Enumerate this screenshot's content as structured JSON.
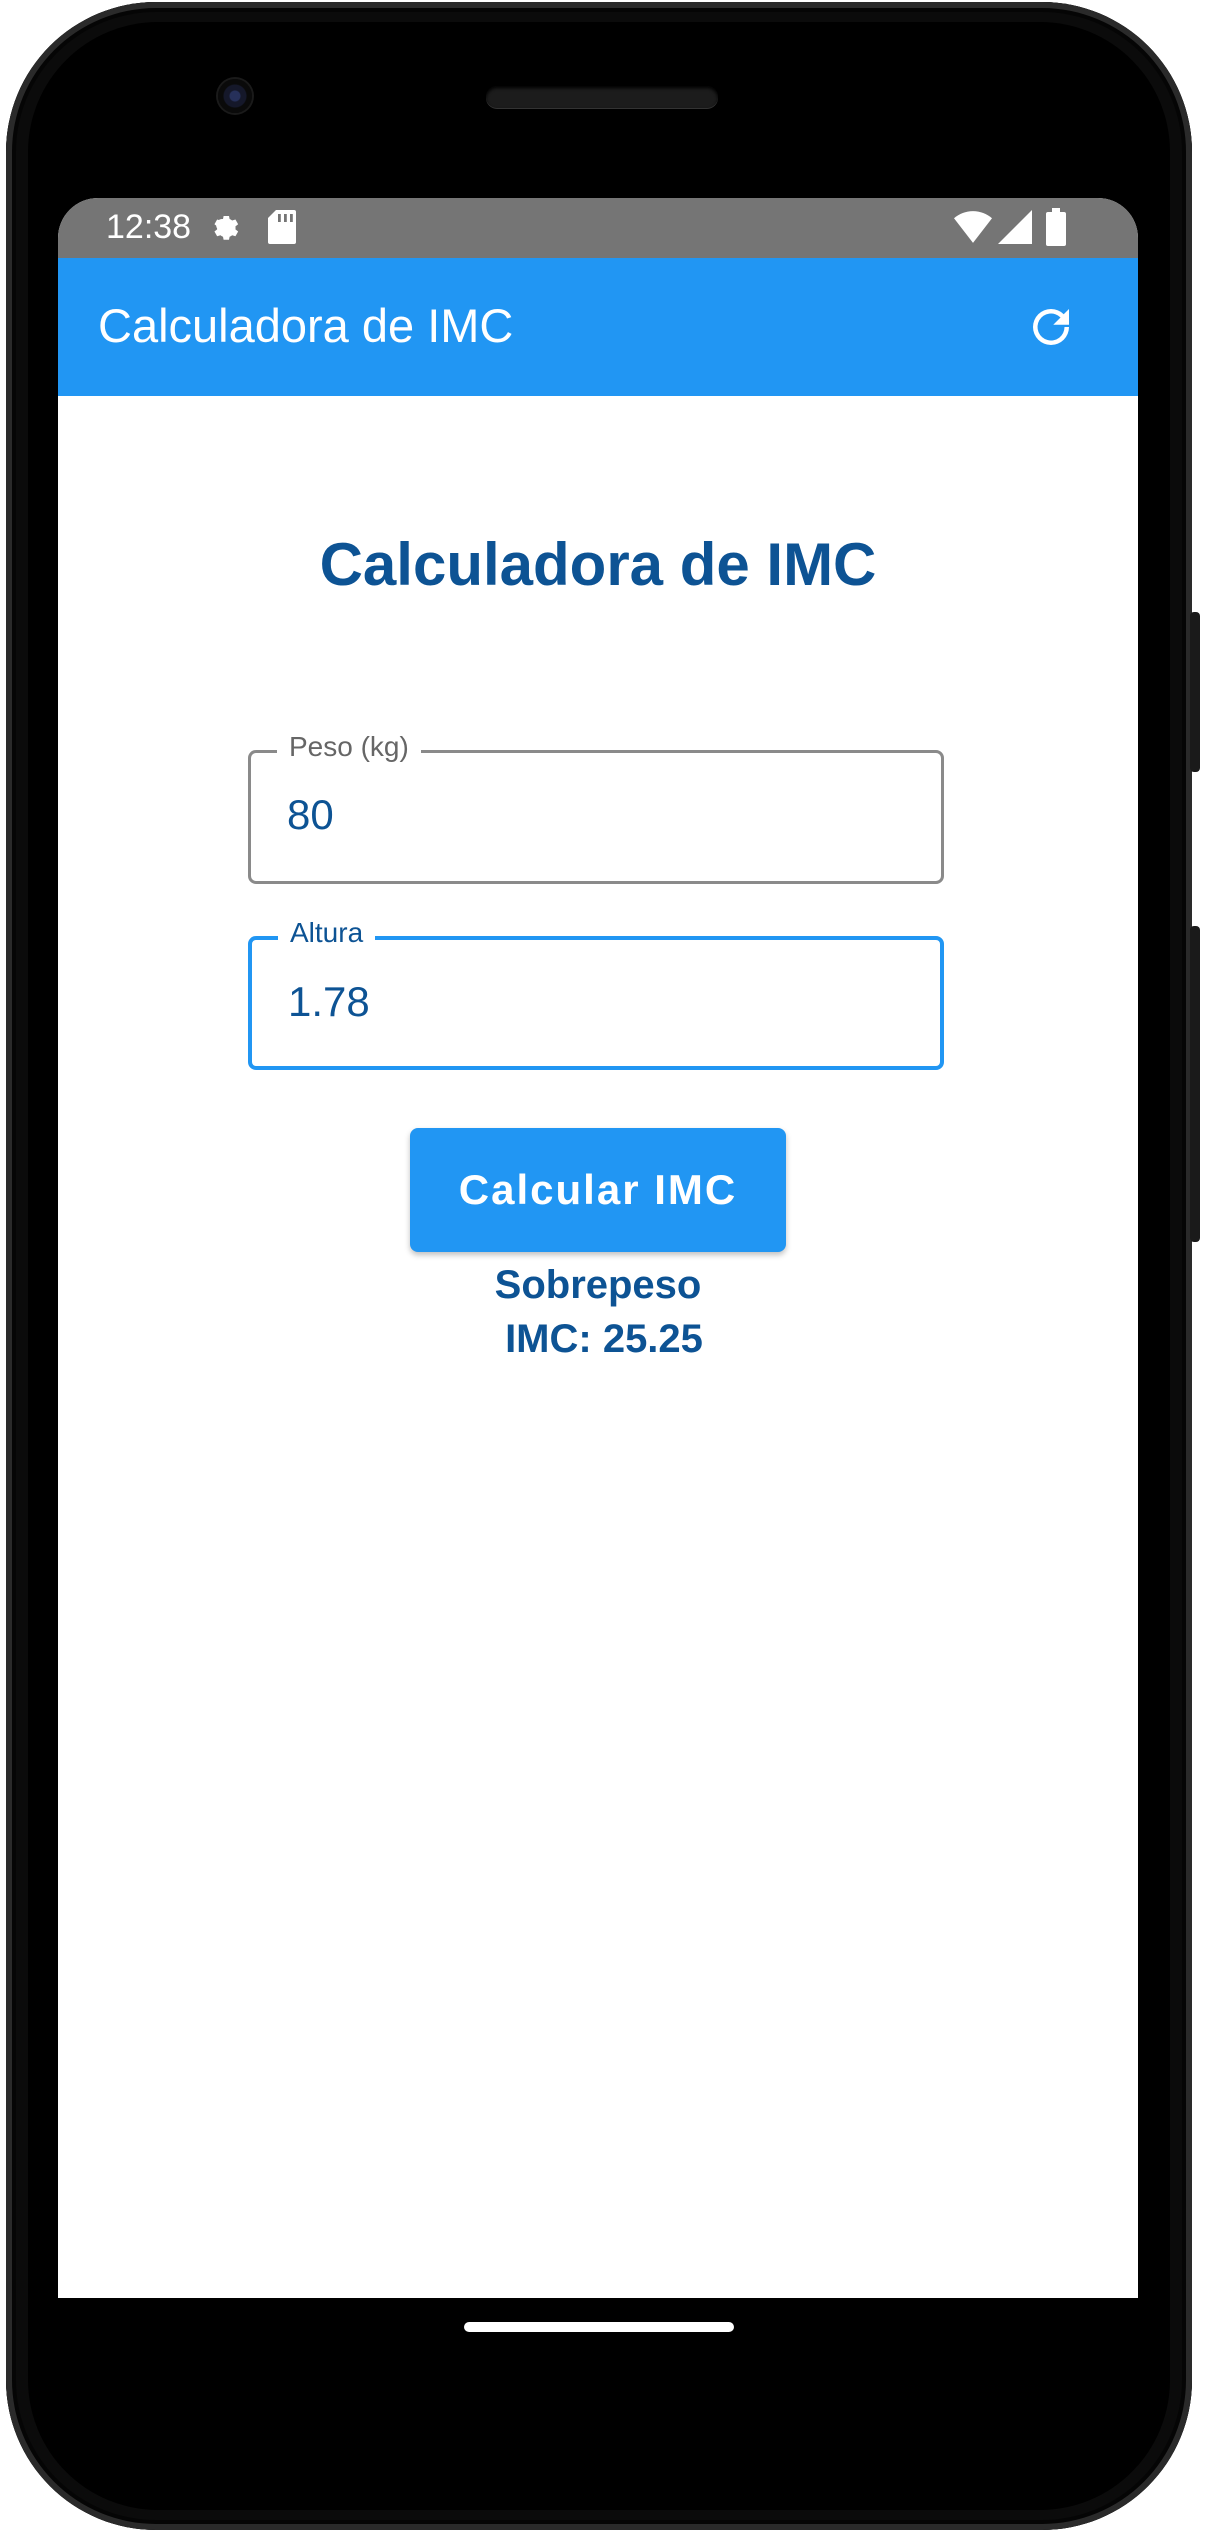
{
  "status_bar": {
    "time": "12:38",
    "icons": [
      "settings-gear-icon",
      "sd-card-icon",
      "wifi-icon",
      "cell-signal-icon",
      "battery-icon"
    ]
  },
  "app_bar": {
    "title": "Calculadora de IMC",
    "action_icon": "refresh-icon"
  },
  "main": {
    "heading": "Calculadora de IMC",
    "peso_field": {
      "label": "Peso (kg)",
      "value": "80"
    },
    "altura_field": {
      "label": "Altura",
      "value": "1.78"
    },
    "calculate_button": "Calcular IMC",
    "result": {
      "category": "Sobrepeso",
      "imc_text": "IMC: 25.25"
    }
  },
  "colors": {
    "primary": "#2196f3",
    "text_dark_blue": "#0d5394",
    "status_bar": "#757575",
    "background": "#ffffff"
  }
}
